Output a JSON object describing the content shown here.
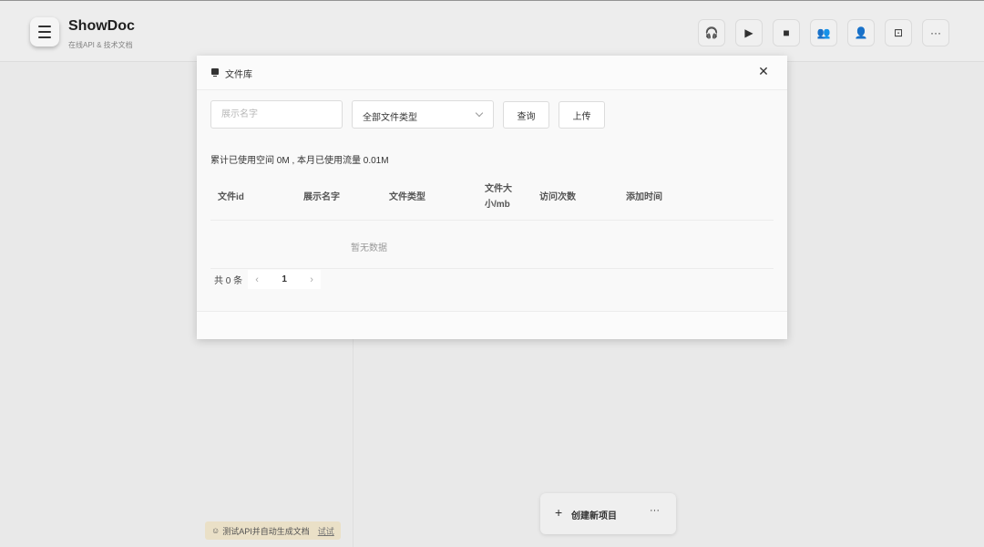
{
  "app": {
    "title": "ShowDoc",
    "subtitle": "在线API & 技术文档"
  },
  "header_icons": [
    {
      "icon": "headset-icon",
      "glyph": "🎧"
    },
    {
      "icon": "folder-icon",
      "glyph": "▶"
    },
    {
      "icon": "message-icon",
      "glyph": "■"
    },
    {
      "icon": "team-icon",
      "glyph": "👥"
    },
    {
      "icon": "user-icon",
      "glyph": "👤"
    },
    {
      "icon": "screen-icon",
      "glyph": "⊡"
    },
    {
      "icon": "more-icon",
      "glyph": "···"
    }
  ],
  "dialog": {
    "title": "文件库",
    "close_glyph": "✕",
    "search": {
      "placeholder": "展示名字",
      "value": ""
    },
    "type_select": {
      "selected": "全部文件类型"
    },
    "query_label": "查询",
    "upload_label": "上传",
    "usage_text": "累计已使用空间 0M , 本月已使用流量 0.01M",
    "table": {
      "columns": [
        "文件id",
        "展示名字",
        "文件类型",
        "文件大小/mb",
        "访问次数",
        "添加时间"
      ],
      "rows": [],
      "empty_text": "暂无数据"
    },
    "pagination": {
      "total_text": "共 0 条",
      "current_page": "1",
      "prev_glyph": "‹",
      "next_glyph": "›"
    }
  },
  "create_project": {
    "plus_glyph": "+",
    "label": "创建新项目",
    "more_glyph": "···"
  },
  "try_banner": {
    "icon_glyph": "☺",
    "text": "测试API并自动生成文档",
    "link": "试试"
  }
}
